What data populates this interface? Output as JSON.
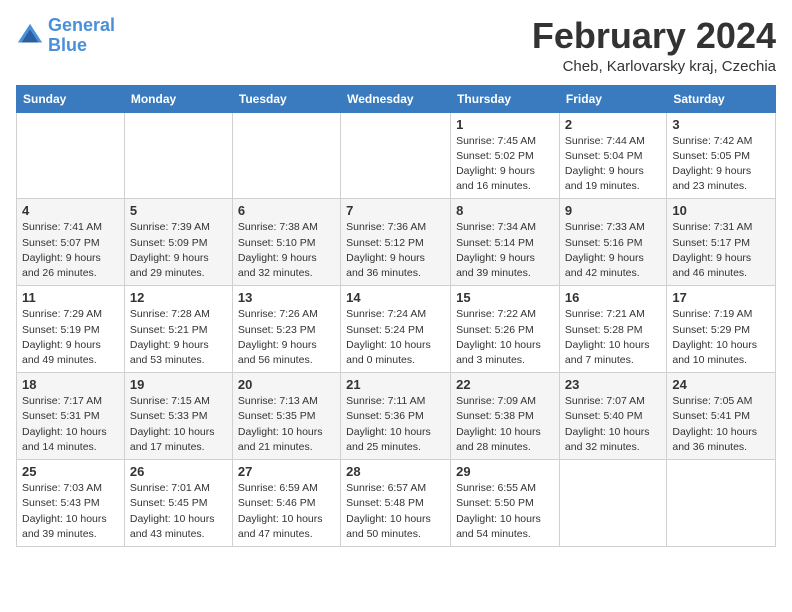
{
  "header": {
    "logo_line1": "General",
    "logo_line2": "Blue",
    "month_title": "February 2024",
    "location": "Cheb, Karlovarsky kraj, Czechia"
  },
  "weekdays": [
    "Sunday",
    "Monday",
    "Tuesday",
    "Wednesday",
    "Thursday",
    "Friday",
    "Saturday"
  ],
  "weeks": [
    [
      {
        "day": "",
        "info": ""
      },
      {
        "day": "",
        "info": ""
      },
      {
        "day": "",
        "info": ""
      },
      {
        "day": "",
        "info": ""
      },
      {
        "day": "1",
        "info": "Sunrise: 7:45 AM\nSunset: 5:02 PM\nDaylight: 9 hours\nand 16 minutes."
      },
      {
        "day": "2",
        "info": "Sunrise: 7:44 AM\nSunset: 5:04 PM\nDaylight: 9 hours\nand 19 minutes."
      },
      {
        "day": "3",
        "info": "Sunrise: 7:42 AM\nSunset: 5:05 PM\nDaylight: 9 hours\nand 23 minutes."
      }
    ],
    [
      {
        "day": "4",
        "info": "Sunrise: 7:41 AM\nSunset: 5:07 PM\nDaylight: 9 hours\nand 26 minutes."
      },
      {
        "day": "5",
        "info": "Sunrise: 7:39 AM\nSunset: 5:09 PM\nDaylight: 9 hours\nand 29 minutes."
      },
      {
        "day": "6",
        "info": "Sunrise: 7:38 AM\nSunset: 5:10 PM\nDaylight: 9 hours\nand 32 minutes."
      },
      {
        "day": "7",
        "info": "Sunrise: 7:36 AM\nSunset: 5:12 PM\nDaylight: 9 hours\nand 36 minutes."
      },
      {
        "day": "8",
        "info": "Sunrise: 7:34 AM\nSunset: 5:14 PM\nDaylight: 9 hours\nand 39 minutes."
      },
      {
        "day": "9",
        "info": "Sunrise: 7:33 AM\nSunset: 5:16 PM\nDaylight: 9 hours\nand 42 minutes."
      },
      {
        "day": "10",
        "info": "Sunrise: 7:31 AM\nSunset: 5:17 PM\nDaylight: 9 hours\nand 46 minutes."
      }
    ],
    [
      {
        "day": "11",
        "info": "Sunrise: 7:29 AM\nSunset: 5:19 PM\nDaylight: 9 hours\nand 49 minutes."
      },
      {
        "day": "12",
        "info": "Sunrise: 7:28 AM\nSunset: 5:21 PM\nDaylight: 9 hours\nand 53 minutes."
      },
      {
        "day": "13",
        "info": "Sunrise: 7:26 AM\nSunset: 5:23 PM\nDaylight: 9 hours\nand 56 minutes."
      },
      {
        "day": "14",
        "info": "Sunrise: 7:24 AM\nSunset: 5:24 PM\nDaylight: 10 hours\nand 0 minutes."
      },
      {
        "day": "15",
        "info": "Sunrise: 7:22 AM\nSunset: 5:26 PM\nDaylight: 10 hours\nand 3 minutes."
      },
      {
        "day": "16",
        "info": "Sunrise: 7:21 AM\nSunset: 5:28 PM\nDaylight: 10 hours\nand 7 minutes."
      },
      {
        "day": "17",
        "info": "Sunrise: 7:19 AM\nSunset: 5:29 PM\nDaylight: 10 hours\nand 10 minutes."
      }
    ],
    [
      {
        "day": "18",
        "info": "Sunrise: 7:17 AM\nSunset: 5:31 PM\nDaylight: 10 hours\nand 14 minutes."
      },
      {
        "day": "19",
        "info": "Sunrise: 7:15 AM\nSunset: 5:33 PM\nDaylight: 10 hours\nand 17 minutes."
      },
      {
        "day": "20",
        "info": "Sunrise: 7:13 AM\nSunset: 5:35 PM\nDaylight: 10 hours\nand 21 minutes."
      },
      {
        "day": "21",
        "info": "Sunrise: 7:11 AM\nSunset: 5:36 PM\nDaylight: 10 hours\nand 25 minutes."
      },
      {
        "day": "22",
        "info": "Sunrise: 7:09 AM\nSunset: 5:38 PM\nDaylight: 10 hours\nand 28 minutes."
      },
      {
        "day": "23",
        "info": "Sunrise: 7:07 AM\nSunset: 5:40 PM\nDaylight: 10 hours\nand 32 minutes."
      },
      {
        "day": "24",
        "info": "Sunrise: 7:05 AM\nSunset: 5:41 PM\nDaylight: 10 hours\nand 36 minutes."
      }
    ],
    [
      {
        "day": "25",
        "info": "Sunrise: 7:03 AM\nSunset: 5:43 PM\nDaylight: 10 hours\nand 39 minutes."
      },
      {
        "day": "26",
        "info": "Sunrise: 7:01 AM\nSunset: 5:45 PM\nDaylight: 10 hours\nand 43 minutes."
      },
      {
        "day": "27",
        "info": "Sunrise: 6:59 AM\nSunset: 5:46 PM\nDaylight: 10 hours\nand 47 minutes."
      },
      {
        "day": "28",
        "info": "Sunrise: 6:57 AM\nSunset: 5:48 PM\nDaylight: 10 hours\nand 50 minutes."
      },
      {
        "day": "29",
        "info": "Sunrise: 6:55 AM\nSunset: 5:50 PM\nDaylight: 10 hours\nand 54 minutes."
      },
      {
        "day": "",
        "info": ""
      },
      {
        "day": "",
        "info": ""
      }
    ]
  ]
}
